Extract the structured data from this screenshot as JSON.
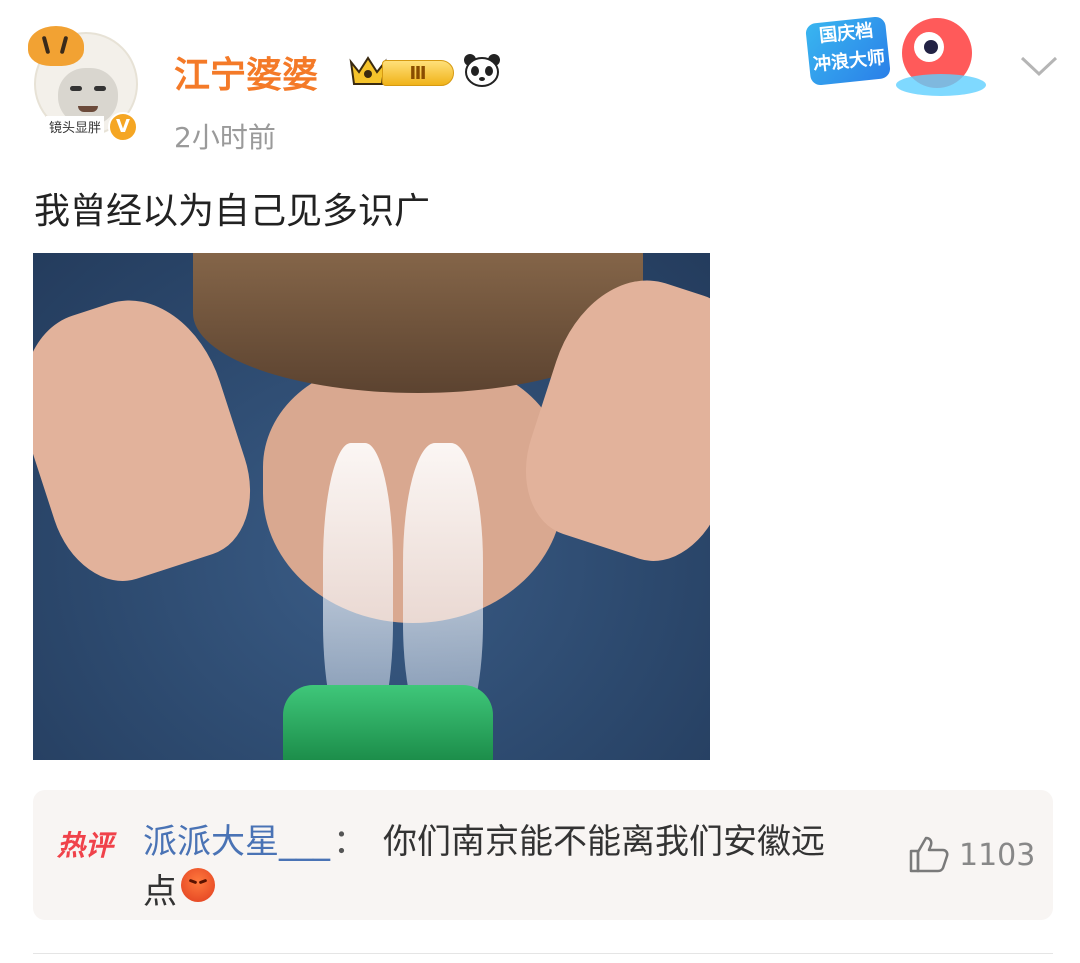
{
  "post": {
    "author": "江宁婆婆",
    "avatar_tag": "镜头显胖",
    "verified_badge": "V",
    "level_badge": "Ⅲ",
    "time": "2小时前",
    "text": "我曾经以为自己见多识广"
  },
  "promo": {
    "line1": "国庆档",
    "line2": "冲浪大师"
  },
  "hot_comment": {
    "label": "热评",
    "user": "派派大星___",
    "separator": "：",
    "text_line1": "你们南京能不能离我们安徽远",
    "text_line2": "点",
    "emoji": "angry-face",
    "likes": "1103"
  },
  "colors": {
    "author_name": "#f47a28",
    "comment_user": "#4a73b5",
    "hot_label": "#f0424a",
    "muted": "#9a9a9a"
  }
}
